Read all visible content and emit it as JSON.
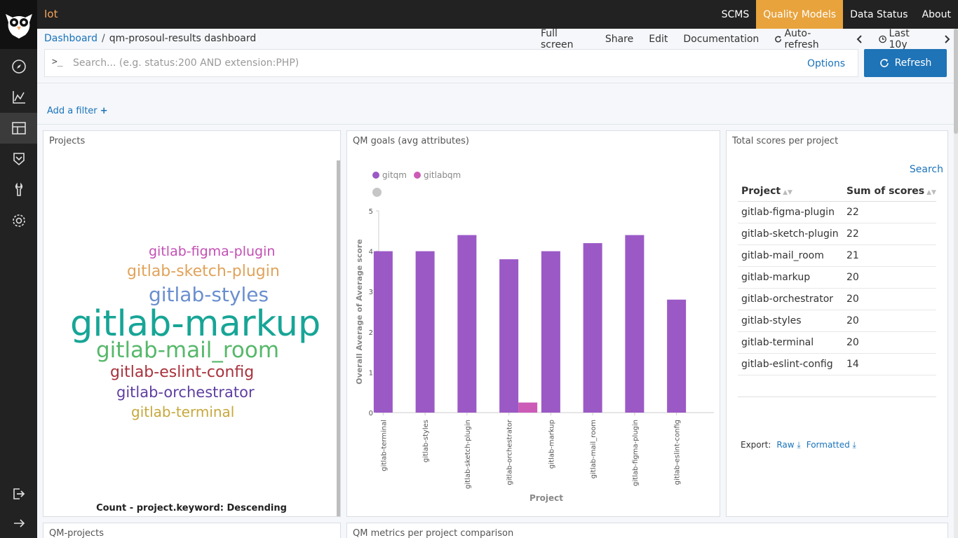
{
  "app": {
    "brand": "Iot",
    "nav": [
      "SCMS",
      "Quality Models",
      "Data Status",
      "About"
    ],
    "active_nav": "Quality Models"
  },
  "sidebar": {
    "icons": [
      "discover-icon",
      "visualize-icon",
      "dashboard-icon",
      "timelion-icon",
      "devtools-icon",
      "management-icon"
    ],
    "bottom_icons": [
      "logout-icon",
      "collapse-icon"
    ]
  },
  "breadcrumb": {
    "root": "Dashboard",
    "sep": "/",
    "current": "qm-prosoul-results dashboard"
  },
  "actions": {
    "full_screen": "Full screen",
    "share": "Share",
    "edit": "Edit",
    "documentation": "Documentation",
    "auto_refresh": "Auto-refresh",
    "time_range": "Last 10y"
  },
  "search": {
    "prompt": ">_",
    "placeholder": "Search... (e.g. status:200 AND extension:PHP)",
    "options": "Options",
    "refresh": "Refresh"
  },
  "filter": {
    "add_label": "Add a filter",
    "plus": "+"
  },
  "panels": {
    "projects": {
      "title": "Projects",
      "words": [
        {
          "text": "gitlab-figma-plugin",
          "color": "#c34fb4"
        },
        {
          "text": "gitlab-sketch-plugin",
          "color": "#e0a35a"
        },
        {
          "text": "gitlab-styles",
          "color": "#6a8fd0"
        },
        {
          "text": "gitlab-markup",
          "color": "#17a596"
        },
        {
          "text": "gitlab-mail_room",
          "color": "#56b86a"
        },
        {
          "text": "gitlab-eslint-config",
          "color": "#a8323c"
        },
        {
          "text": "gitlab-orchestrator",
          "color": "#5e3ea0"
        },
        {
          "text": "gitlab-terminal",
          "color": "#c7a83c"
        }
      ],
      "footer": "Count - project.keyword: Descending"
    },
    "qm_goals": {
      "title": "QM goals (avg attributes)"
    },
    "scores": {
      "title": "Total scores per project",
      "search": "Search",
      "columns": [
        "Project",
        "Sum of scores"
      ],
      "rows": [
        [
          "gitlab-figma-plugin",
          "22"
        ],
        [
          "gitlab-sketch-plugin",
          "22"
        ],
        [
          "gitlab-mail_room",
          "21"
        ],
        [
          "gitlab-markup",
          "20"
        ],
        [
          "gitlab-orchestrator",
          "20"
        ],
        [
          "gitlab-styles",
          "20"
        ],
        [
          "gitlab-terminal",
          "20"
        ],
        [
          "gitlab-eslint-config",
          "14"
        ]
      ],
      "export_label": "Export:",
      "raw": "Raw",
      "formatted": "Formatted"
    },
    "qm_projects": {
      "title": "QM-projects"
    },
    "qm_metrics": {
      "title": "QM metrics per project comparison"
    }
  },
  "chart_data": {
    "type": "bar",
    "categories": [
      "gitlab-terminal",
      "gitlab-styles",
      "gitlab-sketch-plugin",
      "gitlab-orchestrator",
      "gitlab-markup",
      "gitlab-mail_room",
      "gitlab-figma-plugin",
      "gitlab-eslint-config"
    ],
    "series": [
      {
        "name": "gitqm",
        "color": "#9b59c6",
        "values": [
          4,
          4,
          4.4,
          3.8,
          4,
          4.2,
          4.4,
          2.8
        ]
      },
      {
        "name": "gitlabqm",
        "color": "#cc5bb8",
        "values": [
          null,
          null,
          null,
          0.25,
          null,
          null,
          null,
          null
        ]
      }
    ],
    "xlabel": "Project",
    "ylabel": "Overall Average of Average score",
    "ylim": [
      0,
      5
    ],
    "yticks": [
      0,
      1,
      2,
      3,
      4,
      5
    ],
    "legend": "top-left",
    "grid": false
  }
}
